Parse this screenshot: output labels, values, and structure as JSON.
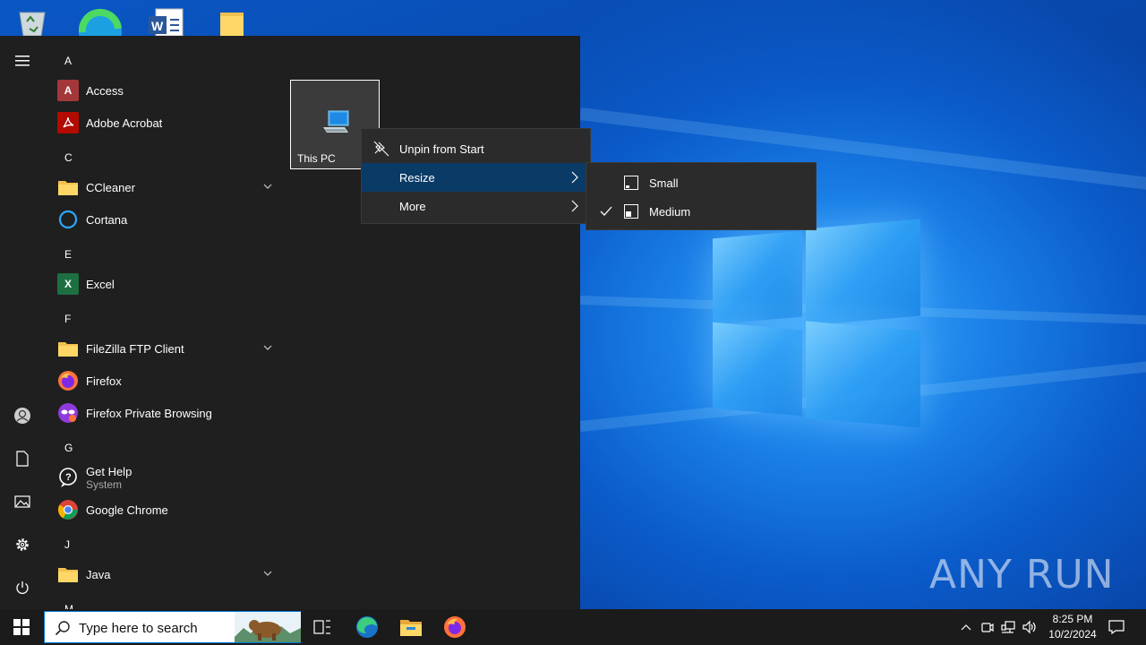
{
  "desktop": {
    "icons": [
      "recycle-bin-icon",
      "edge-icon",
      "word-document-icon",
      "folder-icon"
    ]
  },
  "start_menu": {
    "groups": [
      {
        "letter": "A",
        "apps": [
          {
            "name": "Access",
            "icon": "access-icon"
          },
          {
            "name": "Adobe Acrobat",
            "icon": "acrobat-icon"
          }
        ]
      },
      {
        "letter": "C",
        "apps": [
          {
            "name": "CCleaner",
            "icon": "folder-icon",
            "expandable": true
          },
          {
            "name": "Cortana",
            "icon": "cortana-icon"
          }
        ]
      },
      {
        "letter": "E",
        "apps": [
          {
            "name": "Excel",
            "icon": "excel-icon"
          }
        ]
      },
      {
        "letter": "F",
        "apps": [
          {
            "name": "FileZilla FTP Client",
            "icon": "folder-icon",
            "expandable": true
          },
          {
            "name": "Firefox",
            "icon": "firefox-icon"
          },
          {
            "name": "Firefox Private Browsing",
            "icon": "firefox-private-icon"
          }
        ]
      },
      {
        "letter": "G",
        "apps": [
          {
            "name": "Get Help",
            "sub": "System",
            "icon": "get-help-icon"
          },
          {
            "name": "Google Chrome",
            "icon": "chrome-icon"
          }
        ]
      },
      {
        "letter": "J",
        "apps": [
          {
            "name": "Java",
            "icon": "folder-icon",
            "expandable": true
          }
        ]
      },
      {
        "letter": "M",
        "apps": []
      }
    ],
    "tile": {
      "label": "This PC",
      "icon": "this-pc-icon"
    }
  },
  "context_menu": {
    "items": [
      {
        "label": "Unpin from Start",
        "icon": "unpin-icon"
      },
      {
        "label": "Resize",
        "submenu": true,
        "highlighted": true
      },
      {
        "label": "More",
        "submenu": true
      }
    ]
  },
  "resize_submenu": {
    "items": [
      {
        "label": "Small",
        "checked": false
      },
      {
        "label": "Medium",
        "checked": true
      }
    ]
  },
  "taskbar": {
    "search_placeholder": "Type here to search",
    "time": "8:25 PM",
    "date": "10/2/2024"
  },
  "watermark": "ANY RUN",
  "colors": {
    "start_bg": "#1f1f1f",
    "menu_bg": "#2b2b2b",
    "highlight": "#0a3a66",
    "accent": "#0078d7"
  }
}
